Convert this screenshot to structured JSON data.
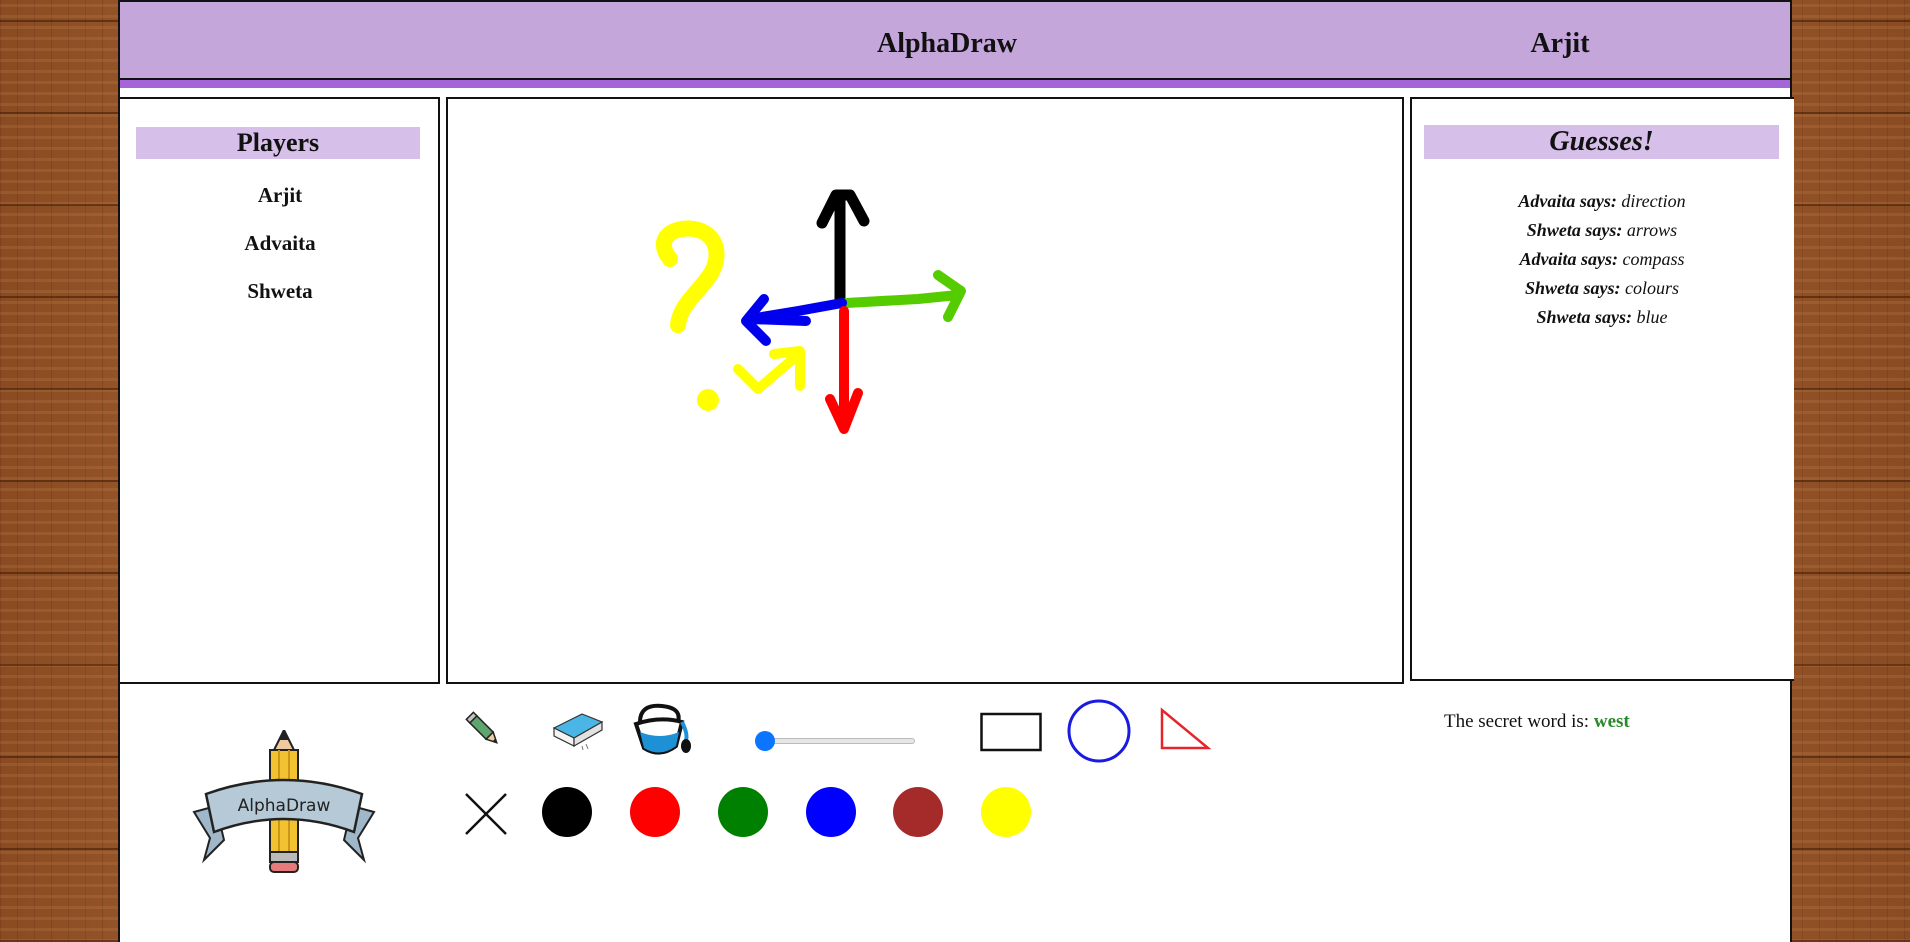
{
  "header": {
    "title": "AlphaDraw",
    "user": "Arjit"
  },
  "players": {
    "heading": "Players",
    "list": [
      "Arjit",
      "Advaita",
      "Shweta"
    ]
  },
  "guesses": {
    "heading": "Guesses!",
    "says": "says:",
    "list": [
      {
        "player": "Advaita",
        "guess": "direction"
      },
      {
        "player": "Shweta",
        "guess": "arrows"
      },
      {
        "player": "Advaita",
        "guess": "compass"
      },
      {
        "player": "Shweta",
        "guess": "colours"
      },
      {
        "player": "Shweta",
        "guess": "blue"
      }
    ]
  },
  "tools": {
    "icons": [
      "pencil-icon",
      "eraser-icon",
      "paint-bucket-icon",
      "rectangle-icon",
      "circle-icon",
      "triangle-icon",
      "clear-icon"
    ],
    "brush_size": 0.0
  },
  "palette": {
    "colors": [
      "#000000",
      "#ff0000",
      "#008000",
      "#0000ff",
      "#a52a2a",
      "#ffff00"
    ],
    "names": [
      "black",
      "red",
      "green",
      "blue",
      "brown",
      "yellow"
    ]
  },
  "logo": {
    "text": "AlphaDraw"
  },
  "secret": {
    "label": "The secret word is:",
    "word": "west"
  },
  "theme": {
    "header_bg": "#c4a6db",
    "header_border": "#a565d9",
    "heading_bg": "#d6bfe8",
    "secret_color": "#2a8a2a"
  }
}
